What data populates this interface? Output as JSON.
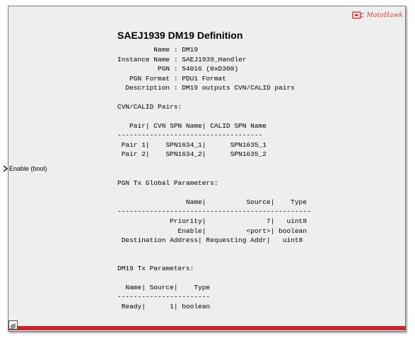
{
  "block": {
    "title": "SAEJ1939 DM19 Definition",
    "logo_text": "MotoHawk",
    "accent_color": "#c8262c",
    "port_icon": "chevron-right-icon",
    "resize_icon": "resize-icon"
  },
  "info": {
    "line1": "         Name : DM19",
    "line2": "Instance Name : SAEJ1939_Handler",
    "line3": "          PGN : 54016 (0xD300)",
    "line4": "   PGN Format : PDU1 Format",
    "line5": "  Description : DM19 outputs CVN/CALID pairs"
  },
  "cvn": {
    "heading": "CVN/CALID Pairs:",
    "header": "   Pair| CVN SPN Name| CALID SPN Name",
    "separator": "------------------------------------",
    "row1": " Pair 1|    SPN1634_1|      SPN1635_1",
    "row2": " Pair 2|    SPN1634_2|      SPN1635_2"
  },
  "port": {
    "label": "Enable (bool)"
  },
  "pgn_tx": {
    "heading": "PGN Tx Global Parameters:",
    "header": "                 Name|          Source|    Type",
    "separator": "------------------------------------------------",
    "row1": "             Priority|               7|   uint8",
    "row2": "               Enable|          <port>| boolean",
    "row3": " Destination Address| Requesting Addr|   uint8"
  },
  "dm19_tx": {
    "heading": "DM19 Tx Parameters:",
    "header": "  Name| Source|    Type",
    "separator": "-----------------------",
    "row1": " Ready|      1| boolean"
  }
}
